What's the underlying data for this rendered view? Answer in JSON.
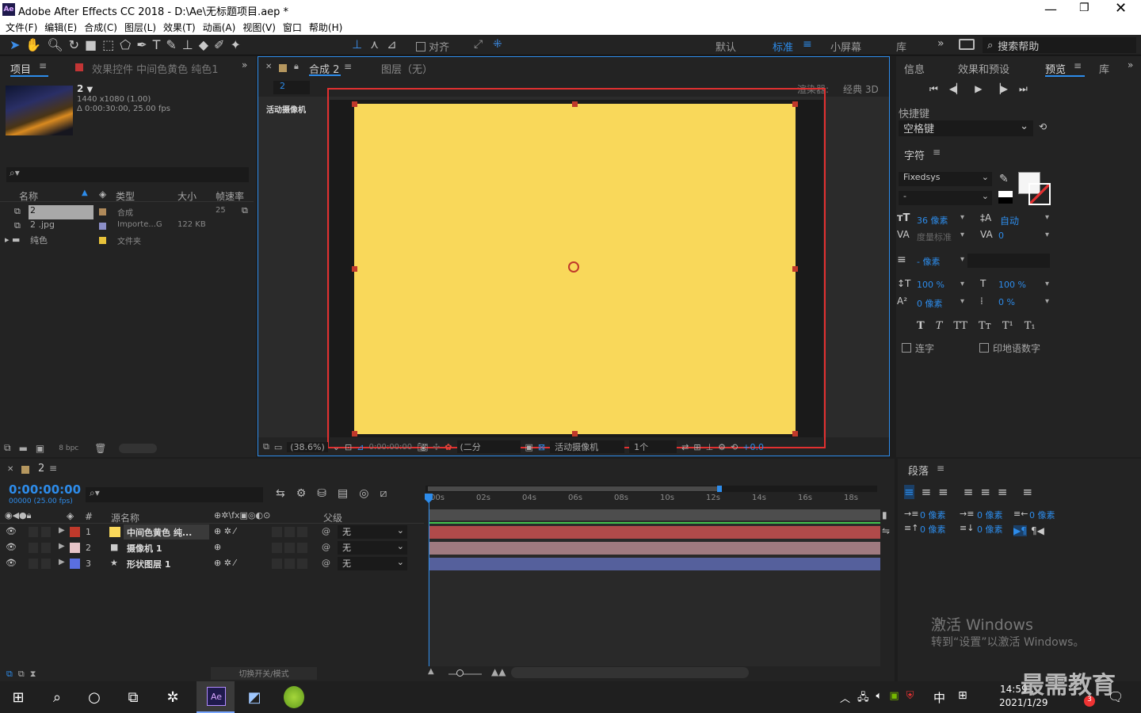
{
  "window": {
    "title": "Adobe After Effects CC 2018 - D:\\Ae\\无标题项目.aep *",
    "app_icon": "Ae"
  },
  "menu": [
    "文件(F)",
    "编辑(E)",
    "合成(C)",
    "图层(L)",
    "效果(T)",
    "动画(A)",
    "视图(V)",
    "窗口",
    "帮助(H)"
  ],
  "toolbar": {
    "snap_label": "对齐",
    "workspaces": [
      "默认",
      "标准",
      "小屏幕",
      "库"
    ],
    "active_workspace": "标准",
    "search_help": "搜索帮助"
  },
  "project_panel": {
    "tab": "项目",
    "effects_tab": "效果控件 中间色黄色 纯色1",
    "comp_name": "2",
    "comp_info1": "1440 x1080 (1.00)",
    "comp_info2": "Δ 0:00:30:00, 25.00 fps",
    "columns": [
      "名称",
      "类型",
      "大小",
      "帧速率"
    ],
    "items": [
      {
        "name": "2",
        "type": "合成",
        "size": "",
        "fps": "25",
        "color": "#b08a5a"
      },
      {
        "name": "2 .jpg",
        "type": "Importe...G",
        "size": "122 KB",
        "fps": "",
        "color": "#8c8fc8"
      },
      {
        "name": "纯色",
        "type": "文件夹",
        "size": "",
        "fps": "",
        "color": "#e8c23a"
      }
    ],
    "bpc": "8 bpc"
  },
  "comp_panel": {
    "tab": "合成 2",
    "layer_tab": "图层（无）",
    "comp_crumb": "2",
    "renderer_label": "渲染器:",
    "renderer_value": "经典 3D",
    "camera_label": "活动摄像机",
    "zoom": "(38.6%)",
    "timecode": "0:00:00:00",
    "resolution": "(二分",
    "view_camera": "活动摄像机",
    "views": "1个",
    "exposure": "+0.0",
    "solid_color": "#f9d85a"
  },
  "right_panel": {
    "tabs": [
      "信息",
      "效果和预设",
      "预览",
      "库"
    ],
    "active_tab": "预览",
    "shortcut_label": "快捷键",
    "shortcut_value": "空格键",
    "character_title": "字符",
    "font": "Fixedsys",
    "font_style": "-",
    "font_size": "36 像素",
    "leading": "自动",
    "kerning": "度量标准",
    "tracking": "0",
    "stroke_width": "- 像素",
    "vscale": "100 %",
    "hscale": "100 %",
    "baseline": "0 像素",
    "tsume": "0 %",
    "ligature": "连字",
    "hindi": "印地语数字",
    "paragraph_title": "段落",
    "indent_values": [
      "0 像素",
      "0 像素",
      "0 像素",
      "0 像素",
      "0 像素"
    ],
    "activate_title": "激活 Windows",
    "activate_sub": "转到“设置”以激活 Windows。"
  },
  "timeline": {
    "tab": "2",
    "timecode": "0:00:00:00",
    "timecode_sub": "00000 (25.00 fps)",
    "col_source": "源名称",
    "col_parent": "父级",
    "toggle_label": "切换开关/模式",
    "ticks": [
      "00s",
      "02s",
      "04s",
      "06s",
      "08s",
      "10s",
      "12s",
      "14s",
      "16s",
      "18s"
    ],
    "layers": [
      {
        "num": "1",
        "name": "中间色黄色 纯...",
        "parent": "无",
        "label_color": "#c0392b",
        "bar_color": "#b04a4a"
      },
      {
        "num": "2",
        "name": "摄像机 1",
        "parent": "无",
        "label_color": "#e7c4c8",
        "bar_color": "#9f7a80"
      },
      {
        "num": "3",
        "name": "形状图层 1",
        "parent": "无",
        "label_color": "#5a6fe0",
        "bar_color": "#55609c"
      }
    ]
  },
  "taskbar": {
    "time": "14:59",
    "date": "2021/1/29",
    "ime": "中",
    "watermark": "最需教育",
    "badge": "3"
  }
}
